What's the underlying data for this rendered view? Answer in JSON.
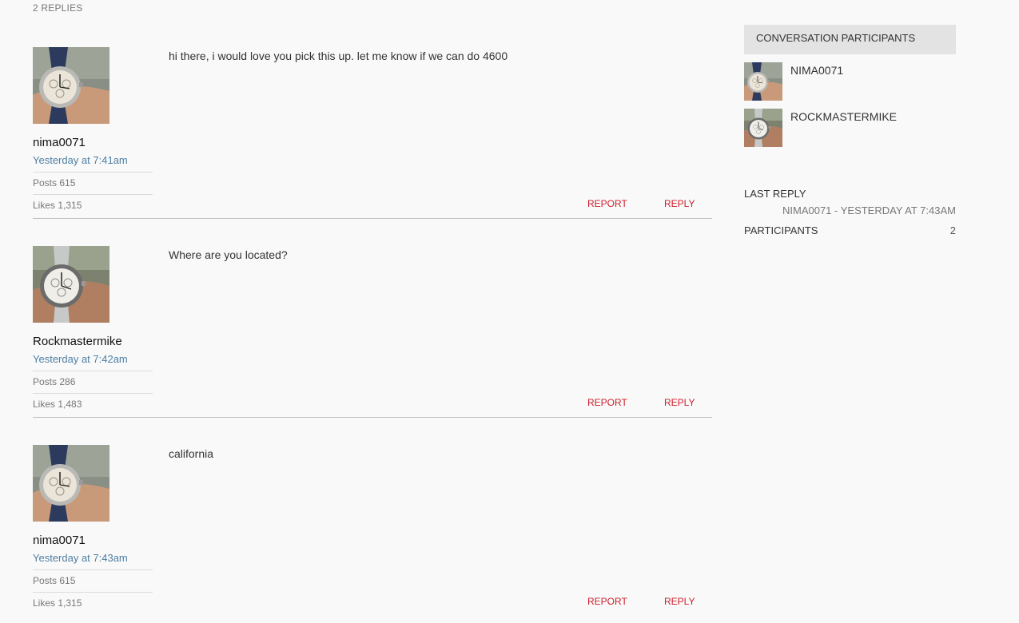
{
  "thread": {
    "replies_count": "2 REPLIES"
  },
  "posts": [
    {
      "username": "nima0071",
      "time": "Yesterday at 7:41am",
      "posts_stat": "Posts 615",
      "likes_stat": "Likes 1,315",
      "message": "hi there, i would love you pick this up. let me know if we can do 4600",
      "report_label": "REPORT",
      "reply_label": "REPLY",
      "avatar_icon": "watch-on-wrist-navy-strap"
    },
    {
      "username": "Rockmastermike",
      "time": "Yesterday at 7:42am",
      "posts_stat": "Posts 286",
      "likes_stat": "Likes 1,483",
      "message": "Where are you located?",
      "report_label": "REPORT",
      "reply_label": "REPLY",
      "avatar_icon": "watch-on-wrist-steel-bracelet"
    },
    {
      "username": "nima0071",
      "time": "Yesterday at 7:43am",
      "posts_stat": "Posts 615",
      "likes_stat": "Likes 1,315",
      "message": "california",
      "report_label": "REPORT",
      "reply_label": "REPLY",
      "avatar_icon": "watch-on-wrist-navy-strap"
    }
  ],
  "sidebar": {
    "header": "CONVERSATION PARTICIPANTS",
    "participants": [
      {
        "name": "NIMA0071",
        "avatar_icon": "watch-on-wrist-navy-strap"
      },
      {
        "name": "ROCKMASTERMIKE",
        "avatar_icon": "watch-on-wrist-steel-bracelet"
      }
    ],
    "last_reply_label": "LAST REPLY",
    "last_reply_value": "NIMA0071 - YESTERDAY AT 7:43AM",
    "participants_label": "PARTICIPANTS",
    "participants_count": "2"
  },
  "colors": {
    "background": "#f9f9f9",
    "link_blue": "#4d7fa3",
    "action_red": "#cc1f2d",
    "header_grey": "#e3e3e3"
  }
}
